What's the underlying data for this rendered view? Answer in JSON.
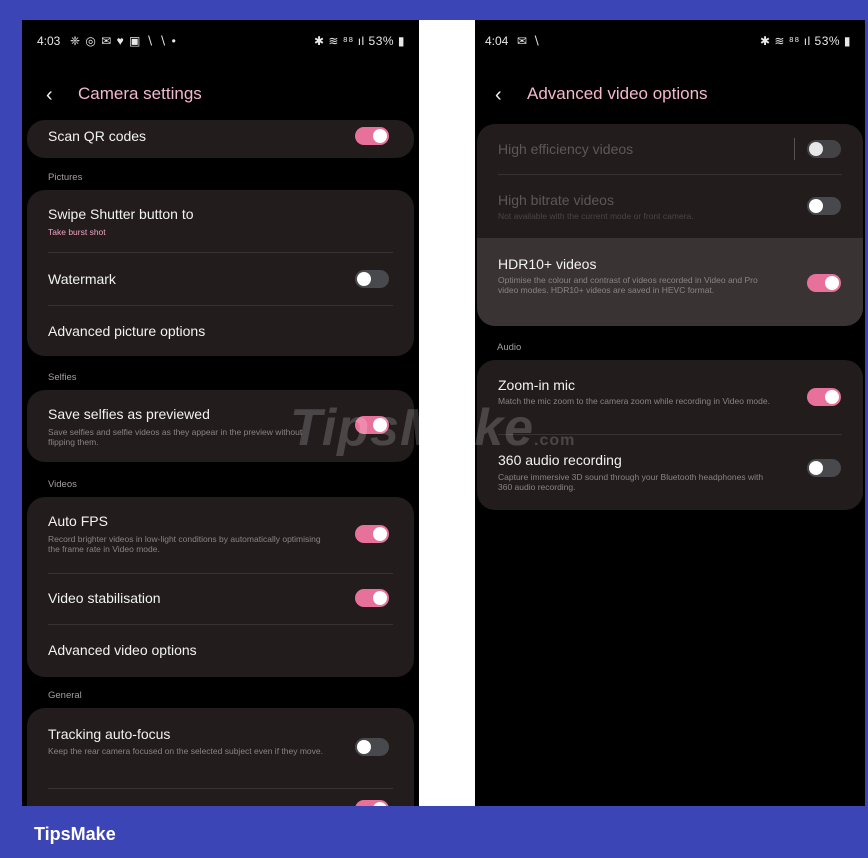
{
  "left": {
    "status": {
      "time": "4:03",
      "icons": "❈ ◎ ✉ ♥ ▣ ∖ ∖ •",
      "right": "✱ ≋ ⁸⁸ ıl 53% ▮"
    },
    "title": "Camera settings",
    "scan_qr": "Scan QR codes",
    "sections": {
      "pictures": "Pictures",
      "selfies": "Selfies",
      "videos": "Videos",
      "general": "General"
    },
    "items": {
      "swipe_shutter": {
        "label": "Swipe Shutter button to",
        "sub": "Take burst shot"
      },
      "watermark": {
        "label": "Watermark"
      },
      "adv_picture": {
        "label": "Advanced picture options"
      },
      "save_selfies": {
        "label": "Save selfies as previewed",
        "sub": "Save selfies and selfie videos as they appear in the preview without flipping them."
      },
      "auto_fps": {
        "label": "Auto FPS",
        "sub": "Record brighter videos in low-light conditions by automatically optimising the frame rate in Video mode."
      },
      "video_stab": {
        "label": "Video stabilisation"
      },
      "adv_video": {
        "label": "Advanced video options"
      },
      "tracking_af": {
        "label": "Tracking auto-focus",
        "sub": "Keep the rear camera focused on the selected subject even if they move."
      }
    }
  },
  "right": {
    "status": {
      "time": "4:04",
      "icons": "✉ ∖",
      "right": "✱ ≋ ⁸⁸ ıl 53% ▮"
    },
    "title": "Advanced video options",
    "sections": {
      "audio": "Audio"
    },
    "items": {
      "high_efficiency": {
        "label": "High efficiency videos"
      },
      "high_bitrate": {
        "label": "High bitrate videos",
        "sub": "Not available with the current mode or front camera."
      },
      "hdr10": {
        "label": "HDR10+ videos",
        "sub": "Optimise the colour and contrast of videos recorded in Video and Pro video modes. HDR10+ videos are saved in HEVC format."
      },
      "zoom_mic": {
        "label": "Zoom-in mic",
        "sub": "Match the mic zoom to the camera zoom while recording in Video mode."
      },
      "audio360": {
        "label": "360 audio recording",
        "sub": "Capture immersive 3D sound through your Bluetooth headphones with 360 audio recording."
      }
    }
  },
  "watermark": {
    "text": "TipsMake",
    "suffix": ".com"
  },
  "brand": "TipsMake",
  "colors": {
    "accent": "#e8719b",
    "frame": "#3b45b6",
    "card": "#221c1d"
  }
}
